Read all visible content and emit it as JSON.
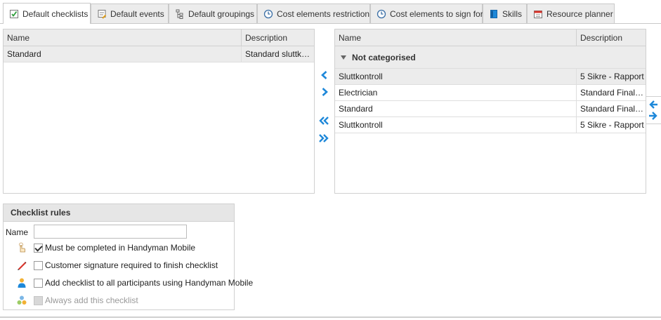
{
  "tabs": [
    {
      "label": "Default checklists",
      "icon": "checklist-icon",
      "active": true
    },
    {
      "label": "Default events",
      "icon": "events-icon"
    },
    {
      "label": "Default groupings",
      "icon": "tree-icon"
    },
    {
      "label": "Cost elements restriction",
      "icon": "clock-icon"
    },
    {
      "label": "Cost elements to sign for",
      "icon": "clock-icon"
    },
    {
      "label": "Skills",
      "icon": "book-icon"
    },
    {
      "label": "Resource planner",
      "icon": "calendar-icon"
    }
  ],
  "left_grid": {
    "headers": {
      "name": "Name",
      "description": "Description"
    },
    "rows": [
      {
        "name": "Standard",
        "description": "Standard sluttkontroll"
      }
    ]
  },
  "right_grid": {
    "headers": {
      "name": "Name",
      "description": "Description"
    },
    "group_label": "Not categorised",
    "rows": [
      {
        "name": "Sluttkontroll",
        "description": "5 Sikre - Rapport"
      },
      {
        "name": "Electrician",
        "description": "Standard Final Inspection"
      },
      {
        "name": "Standard",
        "description": "Standard Final Inspection"
      },
      {
        "name": "Sluttkontroll",
        "description": "5 Sikre - Rapport"
      }
    ]
  },
  "arrow_buttons": [
    "arrow-left-icon",
    "arrow-right-icon",
    "double-arrow-left-icon",
    "double-arrow-right-icon"
  ],
  "rules": {
    "title": "Checklist rules",
    "name_label": "Name",
    "name_value": "",
    "options": [
      {
        "label": "Must be completed in Handyman Mobile",
        "checked": true,
        "disabled": false,
        "icon": "touch-hand-icon"
      },
      {
        "label": "Customer signature required to finish checklist",
        "checked": false,
        "disabled": false,
        "icon": "pen-icon"
      },
      {
        "label": "Add checklist to all participants using Handyman Mobile",
        "checked": false,
        "disabled": false,
        "icon": "user-icon"
      },
      {
        "label": "Always add this checklist",
        "checked": false,
        "disabled": true,
        "icon": "group-icon"
      }
    ]
  },
  "colors": {
    "accent": "#1e88d9",
    "header_bg": "#ececec",
    "border": "#d0d0d0"
  }
}
